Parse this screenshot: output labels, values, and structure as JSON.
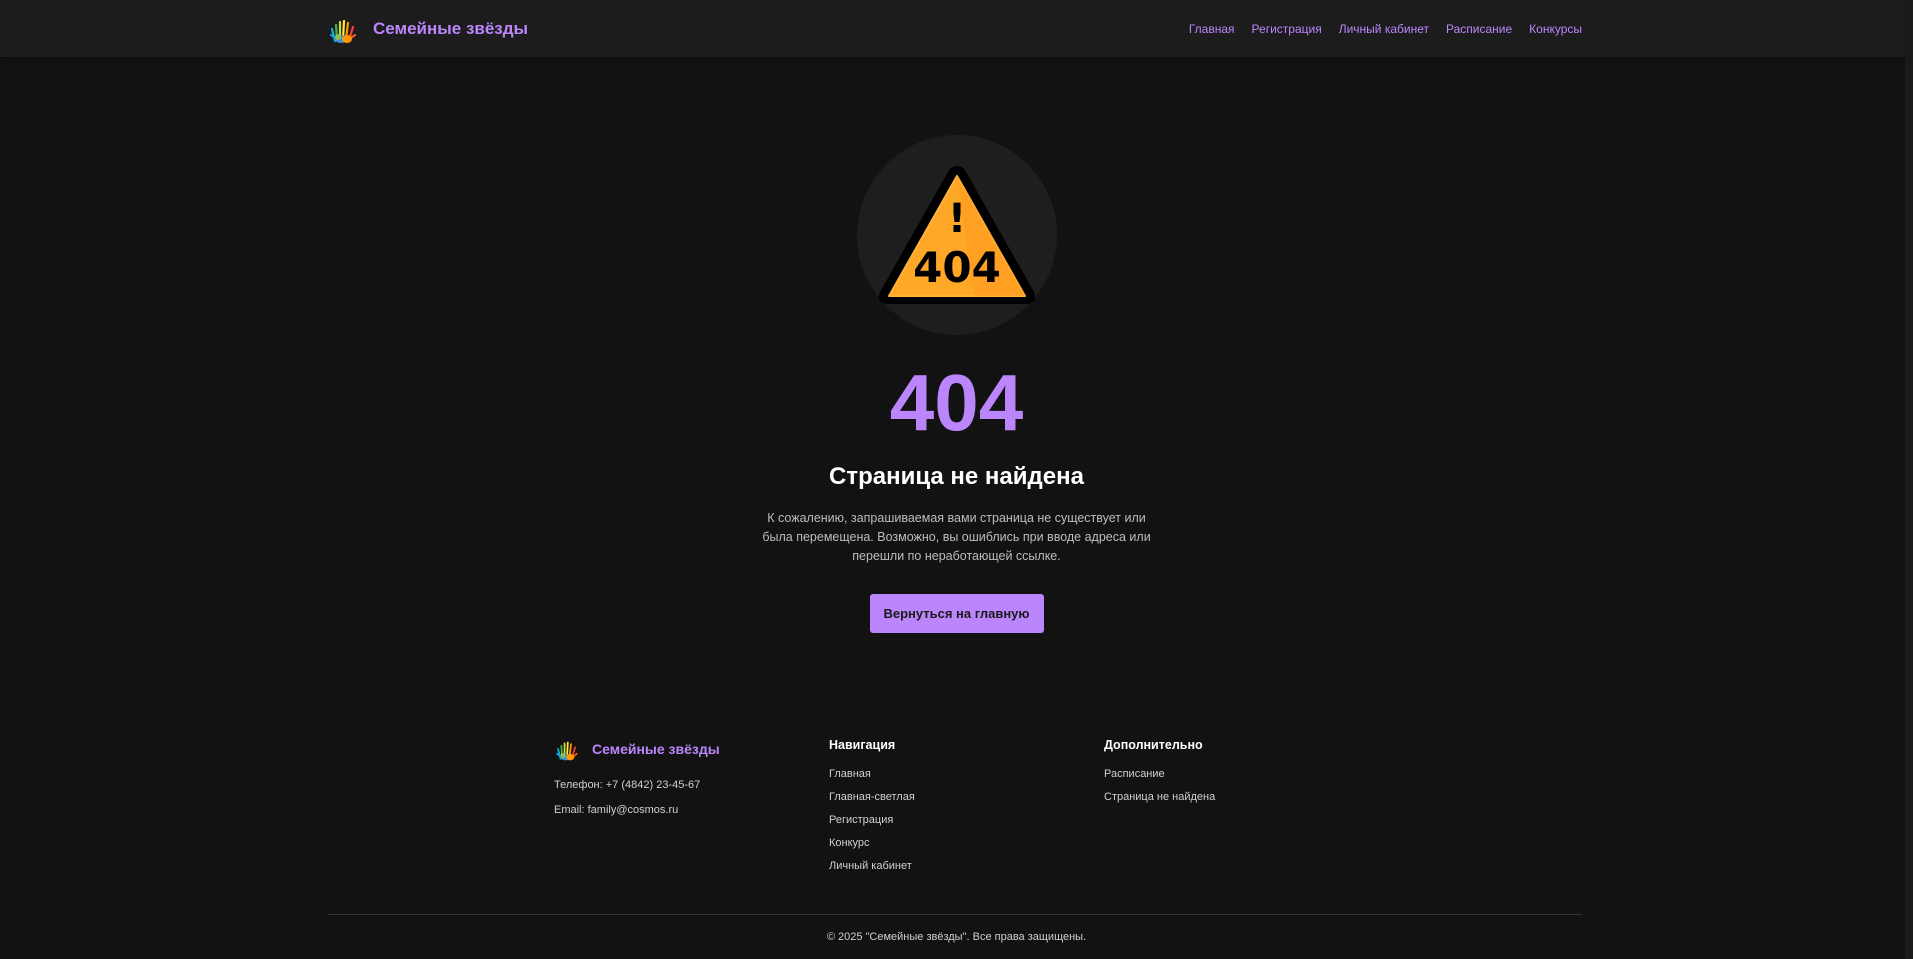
{
  "header": {
    "brand": "Семейные звёзды",
    "nav": [
      "Главная",
      "Регистрация",
      "Личный кабинет",
      "Расписание",
      "Конкурсы"
    ]
  },
  "main": {
    "icon_label": "404",
    "icon_mark": "!",
    "code": "404",
    "title": "Страница не найдена",
    "description": "К сожалению, запрашиваемая вами страница не существует или была перемещена. Возможно, вы ошиблись при вводе адреса или перешли по неработающей ссылке.",
    "button": "Вернуться на главную"
  },
  "footer": {
    "brand": "Семейные звёзды",
    "phone": "Телефон: +7 (4842) 23-45-67",
    "email": "Email: family@cosmos.ru",
    "nav_title": "Навигация",
    "nav_links": [
      "Главная",
      "Главная-светлая",
      "Регистрация",
      "Конкурс",
      "Личный кабинет"
    ],
    "extra_title": "Дополнительно",
    "extra_links": [
      "Расписание",
      "Страница не найдена"
    ],
    "copyright": "© 2025 \"Семейные звёзды\". Все права защищены."
  },
  "colors": {
    "accent": "#bb86fc",
    "background": "#121212",
    "header_bg": "#1c1c1c",
    "warning": "#ffa726"
  },
  "icons": [
    "hands-logo-icon",
    "warning-404-icon"
  ]
}
